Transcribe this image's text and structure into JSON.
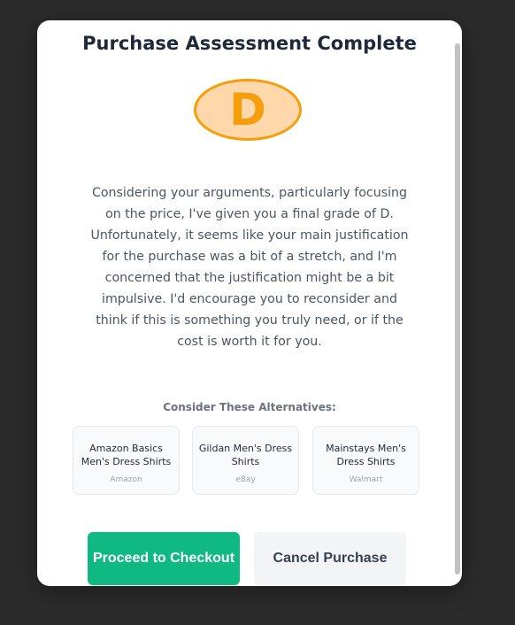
{
  "modal": {
    "title": "Purchase Assessment Complete",
    "grade": "D",
    "assessment": "Considering your arguments, particularly focusing on the price, I've given you a final grade of D. Unfortunately, it seems like your main justification for the purchase was a bit of a stretch, and I'm concerned that the justification might be a bit impulsive. I'd encourage you to reconsider and think if this is something you truly need, or if the cost is worth it for you.",
    "alternatives_heading": "Consider These Alternatives:",
    "alternatives": [
      {
        "name": "Amazon Basics Men's Dress Shirts",
        "source": "Amazon"
      },
      {
        "name": "Gildan Men's Dress Shirts",
        "source": "eBay"
      },
      {
        "name": "Mainstays Men's Dress Shirts",
        "source": "Walmart"
      }
    ],
    "proceed_label": "Proceed to Checkout",
    "cancel_label": "Cancel Purchase"
  },
  "colors": {
    "grade_fill": "#fed7aa",
    "grade_accent": "#f59e0b",
    "proceed": "#10b981",
    "cancel": "#f3f4f6"
  }
}
